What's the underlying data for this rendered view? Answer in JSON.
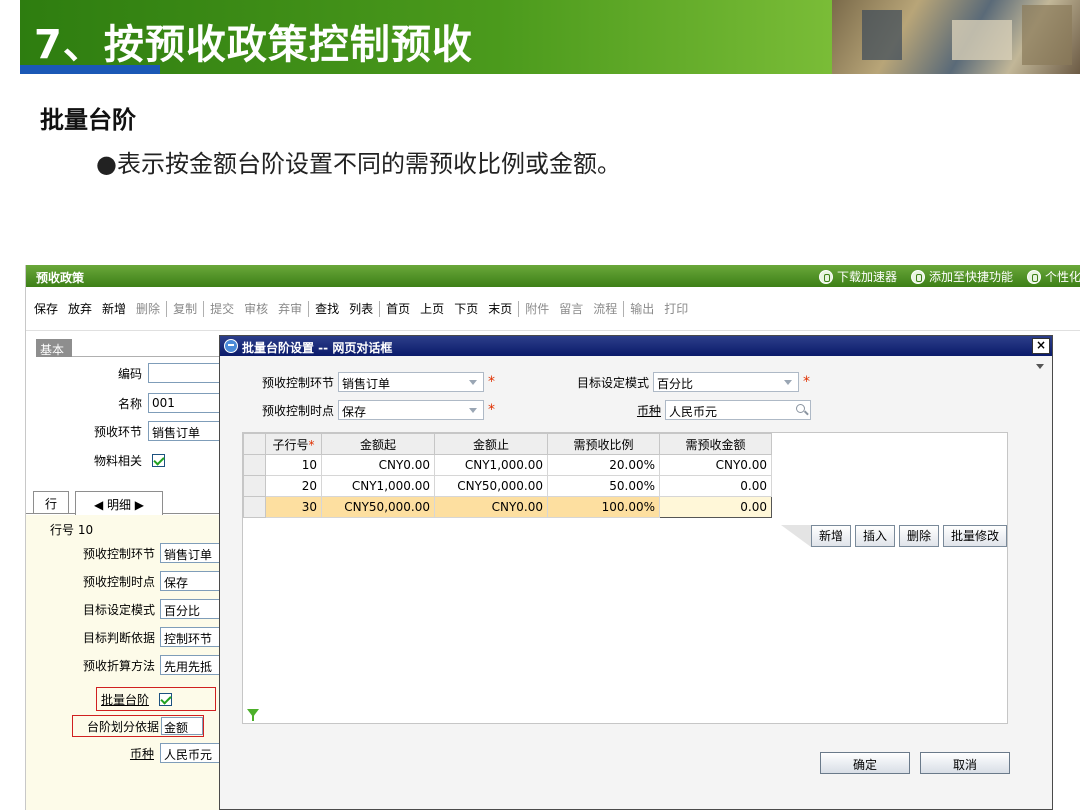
{
  "slide": {
    "title": "7、按预收政策控制预收",
    "heading": "批量台阶",
    "bullet": "●表示按金额台阶设置不同的需预收比例或金额。"
  },
  "app": {
    "title": "预收政策",
    "top_links": [
      "下载加速器",
      "添加至快捷功能",
      "个性化"
    ],
    "toolbar": [
      {
        "label": "保存",
        "disabled": false
      },
      {
        "label": "放弃",
        "disabled": false
      },
      {
        "label": "新增",
        "disabled": false
      },
      {
        "label": "删除",
        "disabled": true
      },
      {
        "sep": true
      },
      {
        "label": "复制",
        "disabled": true
      },
      {
        "sep": true
      },
      {
        "label": "提交",
        "disabled": true
      },
      {
        "label": "审核",
        "disabled": true
      },
      {
        "label": "弃审",
        "disabled": true
      },
      {
        "sep": true
      },
      {
        "label": "查找",
        "disabled": false
      },
      {
        "label": "列表",
        "disabled": false
      },
      {
        "sep": true
      },
      {
        "label": "首页",
        "disabled": false
      },
      {
        "label": "上页",
        "disabled": false
      },
      {
        "label": "下页",
        "disabled": false
      },
      {
        "label": "末页",
        "disabled": false
      },
      {
        "sep": true
      },
      {
        "label": "附件",
        "disabled": true
      },
      {
        "label": "留言",
        "disabled": true
      },
      {
        "label": "流程",
        "disabled": true
      },
      {
        "sep": true
      },
      {
        "label": "输出",
        "disabled": true
      },
      {
        "label": "打印",
        "disabled": true
      }
    ]
  },
  "left": {
    "tab_basic": "基本",
    "fields": {
      "code_label": "编码",
      "code_value": "",
      "name_label": "名称",
      "name_value": "001",
      "stage_label": "预收环节",
      "stage_value": "销售订单",
      "material_label": "物料相关"
    },
    "tab_row": "行",
    "tab_detail": "◀ 明细 ▶",
    "row_no": "行号 10",
    "detail": [
      {
        "label": "预收控制环节",
        "value": "销售订单"
      },
      {
        "label": "预收控制时点",
        "value": "保存"
      },
      {
        "label": "目标设定模式",
        "value": "百分比"
      },
      {
        "label": "目标判断依据",
        "value": "控制环节"
      },
      {
        "label": "预收折算方法",
        "value": "先用先抵"
      }
    ],
    "batch_step_label": "批量台阶",
    "step_basis_label": "台阶划分依据",
    "step_basis_value": "金额",
    "currency_label": "币种",
    "currency_value": "人民币元"
  },
  "dialog": {
    "title": "批量台阶设置 -- 网页对话框",
    "close": "×",
    "stage_label": "预收控制环节",
    "stage_value": "销售订单",
    "point_label": "预收控制时点",
    "point_value": "保存",
    "mode_label": "目标设定模式",
    "mode_value": "百分比",
    "currency_label": "币种",
    "currency_value": "人民币元",
    "req_mark": "*",
    "columns": [
      "子行号",
      "金额起",
      "金额止",
      "需预收比例",
      "需预收金额"
    ],
    "rows": [
      {
        "no": "10",
        "from": "CNY0.00",
        "to": "CNY1,000.00",
        "ratio": "20.00%",
        "amount": "CNY0.00"
      },
      {
        "no": "20",
        "from": "CNY1,000.00",
        "to": "CNY50,000.00",
        "ratio": "50.00%",
        "amount": "0.00"
      },
      {
        "no": "30",
        "from": "CNY50,000.00",
        "to": "CNY0.00",
        "ratio": "100.00%",
        "amount": "0.00"
      }
    ],
    "grid_buttons": [
      "新增",
      "插入",
      "删除",
      "批量修改"
    ],
    "ok": "确定",
    "cancel": "取消"
  }
}
